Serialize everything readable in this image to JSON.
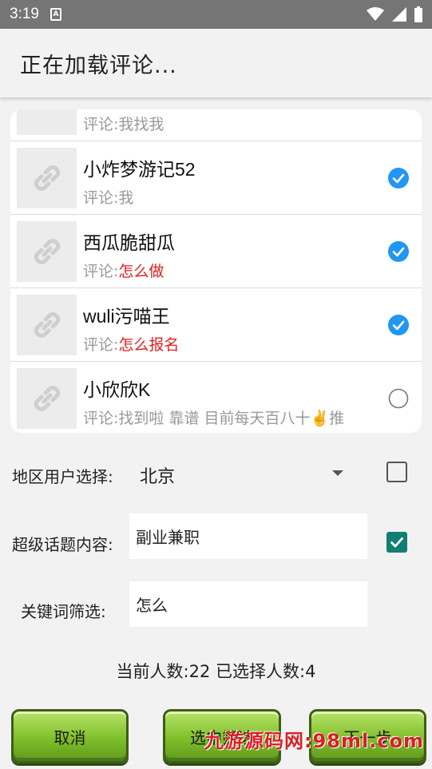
{
  "status_bar": {
    "time": "3:19"
  },
  "header": {
    "title": "正在加载评论..."
  },
  "comments": [
    {
      "name": "",
      "prefix": "评论:",
      "text": "我找我",
      "keyword": "",
      "checked": false,
      "partial": true
    },
    {
      "name": "小炸梦游记52",
      "prefix": "评论:",
      "text": "我",
      "keyword": "",
      "checked": true
    },
    {
      "name": "西瓜脆甜瓜",
      "prefix": "评论:",
      "text": "",
      "keyword": "怎么做",
      "checked": true
    },
    {
      "name": "wuli污喵王",
      "prefix": "评论:",
      "text": "",
      "keyword": "怎么报名",
      "checked": true
    },
    {
      "name": "小欣欣K",
      "prefix": "评论:",
      "text": "找到啦 靠谱 目前每天百八十✌️推",
      "keyword": "",
      "checked": false
    }
  ],
  "filters": {
    "region_label": "地区用户选择:",
    "region_value": "北京",
    "region_checked": false,
    "topic_label": "超级话题内容:",
    "topic_value": "副业兼职",
    "topic_checked": true,
    "keyword_label": "关键词筛选:",
    "keyword_value": "怎么"
  },
  "summary": {
    "text": "当前人数:22 已选择人数:4"
  },
  "buttons": {
    "cancel": "取消",
    "select": "选中筛选",
    "next": "下一步"
  },
  "watermark": "九游源码网:98ml.com",
  "colors": {
    "accent_blue": "#2196f3",
    "checkbox_teal": "#137e73",
    "keyword_red": "#e02020",
    "status_bar": "#757575"
  }
}
